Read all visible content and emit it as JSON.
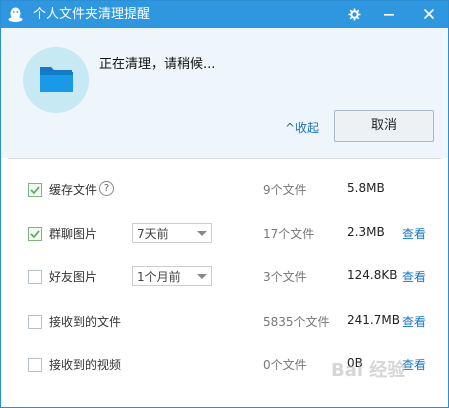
{
  "titlebar": {
    "title": "个人文件夹清理提醒"
  },
  "header": {
    "status_text": "正在清理，请稍候...",
    "collapse_link": "^收起",
    "cancel_button": "取消"
  },
  "rows": [
    {
      "label": "缓存文件",
      "checked": true,
      "count": "9个文件",
      "size": "5.8MB",
      "view": ""
    },
    {
      "label": "群聊图片",
      "checked": true,
      "dropdown": "7天前",
      "count": "17个文件",
      "size": "2.3MB",
      "view": "查看"
    },
    {
      "label": "好友图片",
      "checked": false,
      "dropdown": "1个月前",
      "count": "3个文件",
      "size": "124.8KB",
      "view": "查看"
    },
    {
      "label": "接收到的文件",
      "checked": false,
      "count": "5835个文件",
      "size": "241.7MB",
      "view": "查看"
    },
    {
      "label": "接收到的视频",
      "checked": false,
      "count": "0个文件",
      "size": "0B",
      "view": "查看"
    }
  ],
  "help_icon": "?",
  "watermark": "Bai 经验",
  "colors": {
    "titlebar": "#2f97e0",
    "link": "#1a77c0",
    "header_bg": "#eef6fb"
  }
}
